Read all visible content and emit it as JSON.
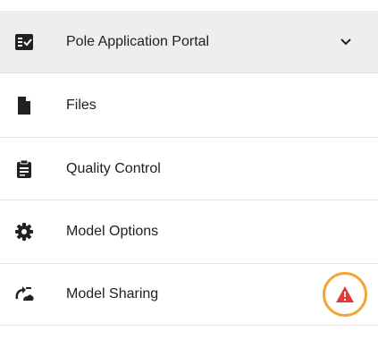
{
  "menu": {
    "header": {
      "label": "Pole Application Portal",
      "icon": "checklist-icon",
      "expanded": false
    },
    "items": [
      {
        "label": "Files",
        "icon": "file-icon"
      },
      {
        "label": "Quality Control",
        "icon": "clipboard-icon"
      },
      {
        "label": "Model Options",
        "icon": "gear-icon"
      },
      {
        "label": "Model Sharing",
        "icon": "share-cloud-icon"
      }
    ]
  },
  "alert": {
    "icon": "warning-triangle-icon",
    "ring_color": "#f0a830",
    "icon_color": "#e53935"
  },
  "colors": {
    "header_bg": "#eeeeee",
    "divider": "#e0e0e0",
    "text": "#212121",
    "icon": "#212121"
  }
}
